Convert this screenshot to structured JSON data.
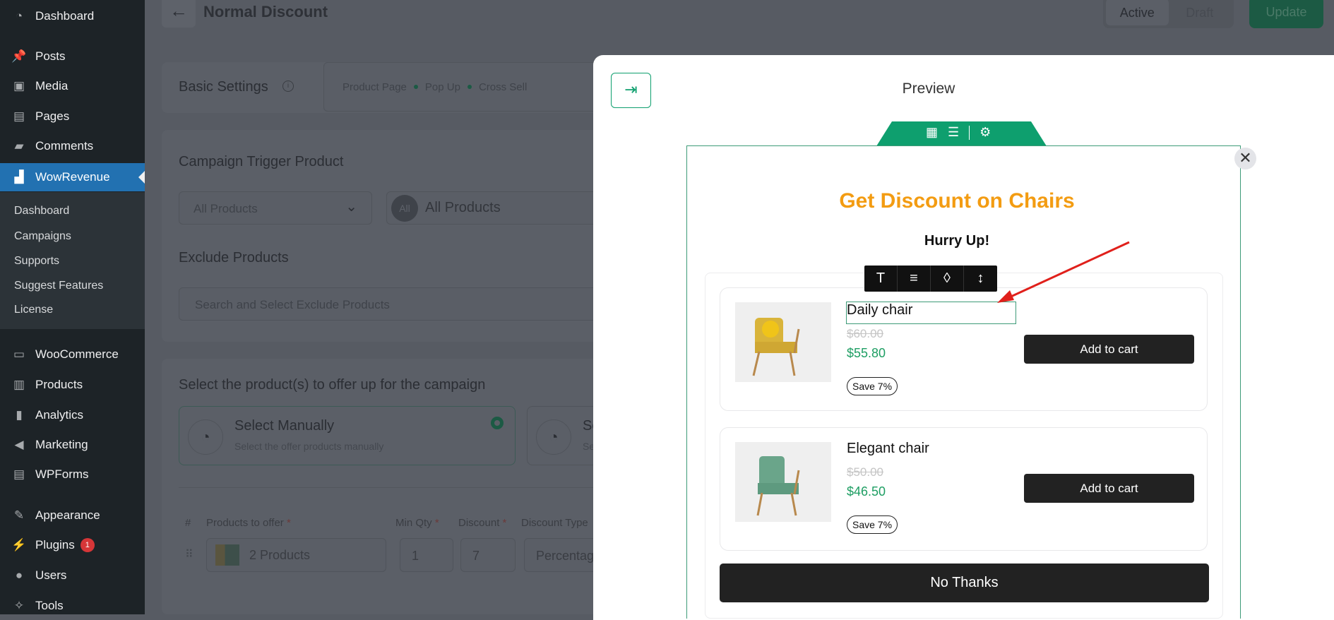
{
  "sidebar": {
    "items": [
      {
        "label": "Dashboard",
        "icon": "dashboard-icon"
      },
      {
        "label": "Posts",
        "icon": "pin-icon"
      },
      {
        "label": "Media",
        "icon": "media-icon"
      },
      {
        "label": "Pages",
        "icon": "pages-icon"
      },
      {
        "label": "Comments",
        "icon": "comment-icon"
      },
      {
        "label": "WowRevenue",
        "icon": "wowrevenue-icon"
      },
      {
        "label": "WooCommerce",
        "icon": "woo-icon"
      },
      {
        "label": "Products",
        "icon": "archive-icon"
      },
      {
        "label": "Analytics",
        "icon": "bar-chart-icon"
      },
      {
        "label": "Marketing",
        "icon": "megaphone-icon"
      },
      {
        "label": "WPForms",
        "icon": "form-icon"
      },
      {
        "label": "Appearance",
        "icon": "brush-icon"
      },
      {
        "label": "Plugins",
        "icon": "plug-icon",
        "badge": "1"
      },
      {
        "label": "Users",
        "icon": "user-icon"
      },
      {
        "label": "Tools",
        "icon": "wrench-icon"
      }
    ],
    "submenu": [
      "Dashboard",
      "Campaigns",
      "Supports",
      "Suggest Features",
      "License"
    ]
  },
  "header": {
    "title": "Normal Discount",
    "status_active": "Active",
    "status_draft": "Draft",
    "update": "Update"
  },
  "basic": {
    "title": "Basic Settings",
    "steps": [
      "Product Page",
      "Pop Up",
      "Cross Sell"
    ]
  },
  "trigger": {
    "title": "Campaign Trigger Product",
    "select": "All Products",
    "chip_icon": "All",
    "chip": "All Products"
  },
  "exclude": {
    "title": "Exclude Products",
    "placeholder": "Search and Select Exclude Products"
  },
  "offer": {
    "title": "Select the product(s) to offer up for the campaign",
    "manual_title": "Select Manually",
    "manual_desc": "Select the offer products manually",
    "second_title": "Se",
    "second_desc": "Se"
  },
  "table": {
    "headers": [
      "#",
      "Products to offer",
      "Min Qty",
      "Discount",
      "Discount Type"
    ],
    "row": {
      "products": "2 Products",
      "min_qty": "1",
      "discount": "7",
      "type": "Percentag"
    }
  },
  "preview": {
    "title": "Preview",
    "popup": {
      "heading": "Hurry Up!",
      "title": "Get Discount on Chairs",
      "title_color": "#f39c12",
      "no_thanks": "No Thanks",
      "products": [
        {
          "name": "Daily chair",
          "old_price": "$60.00",
          "price": "$55.80",
          "save": "Save 7%",
          "cta": "Add to cart",
          "color": "#d9b43a"
        },
        {
          "name": "Elegant chair",
          "old_price": "$50.00",
          "price": "$46.50",
          "save": "Save 7%",
          "cta": "Add to cart",
          "color": "#6aa58a"
        }
      ]
    }
  },
  "colors": {
    "accent": "#0e9f6e",
    "wp_blue": "#2271b1"
  }
}
